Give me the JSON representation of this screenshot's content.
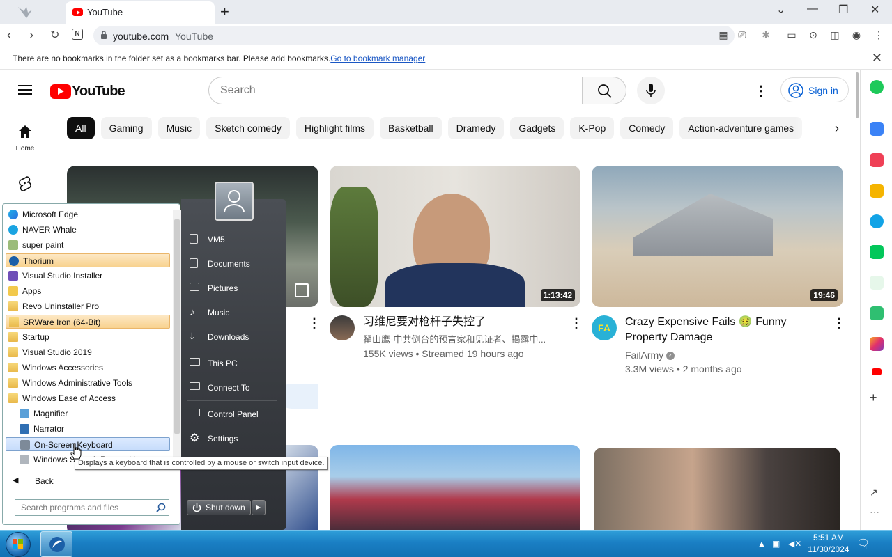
{
  "browser": {
    "tab_title": "YouTube",
    "url": "youtube.com",
    "url_title": "YouTube",
    "bookmarks_message": "There are no bookmarks in the folder set as a bookmarks bar. Please add bookmarks.",
    "bookmarks_link": "Go to bookmark manager"
  },
  "youtube": {
    "logo_text": "YouTube",
    "search_placeholder": "Search",
    "signin_label": "Sign in",
    "home_label": "Home",
    "chips": [
      "All",
      "Gaming",
      "Music",
      "Sketch comedy",
      "Highlight films",
      "Basketball",
      "Dramedy",
      "Gadgets",
      "K-Pop",
      "Comedy",
      "Action-adventure games"
    ],
    "videos": [
      {
        "title": "习维尼要对枪杆子失控了",
        "channel": "翟山鹰-中共倒台的预言家和见证者、揭露中...",
        "meta": "155K views • Streamed 19 hours ago",
        "duration": "1:13:42"
      },
      {
        "title": "Crazy Expensive Fails 🤢 Funny Property Damage",
        "channel": "FailArmy",
        "meta": "3.3M views • 2 months ago",
        "duration": "19:46",
        "avatar_text": "FA"
      }
    ]
  },
  "startmenu": {
    "programs": [
      {
        "label": "Microsoft Edge",
        "icon": "edge-icon"
      },
      {
        "label": "NAVER Whale",
        "icon": "whale-icon"
      },
      {
        "label": "super paint",
        "icon": "paint-icon"
      },
      {
        "label": "Thorium",
        "icon": "thorium-icon",
        "state": "highlighted"
      },
      {
        "label": "Visual Studio Installer",
        "icon": "installer-icon"
      },
      {
        "label": "Apps",
        "icon": "apps-icon"
      },
      {
        "label": "Revo Uninstaller Pro",
        "icon": "folder-icon"
      },
      {
        "label": "SRWare Iron (64-Bit)",
        "icon": "folder-icon",
        "state": "highlighted"
      },
      {
        "label": "Startup",
        "icon": "folder-icon"
      },
      {
        "label": "Visual Studio 2019",
        "icon": "folder-icon"
      },
      {
        "label": "Windows Accessories",
        "icon": "folder-icon"
      },
      {
        "label": "Windows Administrative Tools",
        "icon": "folder-icon"
      },
      {
        "label": "Windows Ease of Access",
        "icon": "folder-icon"
      },
      {
        "label": "Magnifier",
        "icon": "magnifier-icon",
        "sub": true
      },
      {
        "label": "Narrator",
        "icon": "narrator-icon",
        "sub": true
      },
      {
        "label": "On-Screen Keyboard",
        "icon": "keyboard-icon",
        "sub": true,
        "state": "selected"
      },
      {
        "label": "Windows Speech Recognition",
        "icon": "microphone-icon",
        "sub": true
      }
    ],
    "back_label": "Back",
    "search_placeholder": "Search programs and files",
    "right_links": [
      "VM5",
      "Documents",
      "Pictures",
      "Music",
      "Downloads",
      "This PC",
      "Connect To",
      "Control Panel",
      "Settings"
    ],
    "shutdown_label": "Shut down",
    "tooltip": "Displays a keyboard that is controlled by a mouse or switch input device."
  },
  "taskbar": {
    "time": "5:51 AM",
    "date": "11/30/2024",
    "notification_count": "1"
  }
}
